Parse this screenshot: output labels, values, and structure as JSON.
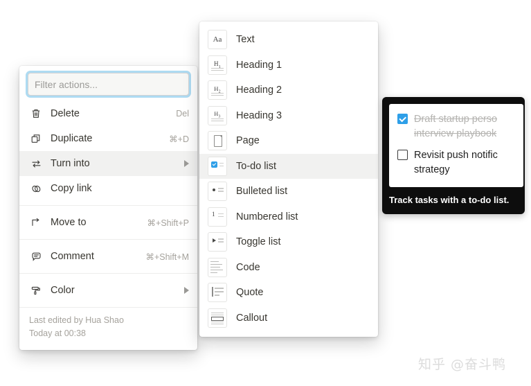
{
  "block_menu": {
    "filter": {
      "placeholder": "Filter actions...",
      "value": ""
    },
    "groups": [
      {
        "items": [
          {
            "icon": "trash-icon",
            "label": "Delete",
            "shortcut": "Del",
            "submenu": false,
            "active": false
          },
          {
            "icon": "duplicate-icon",
            "label": "Duplicate",
            "shortcut": "⌘+D",
            "submenu": false,
            "active": false
          },
          {
            "icon": "turn-into-icon",
            "label": "Turn into",
            "shortcut": "",
            "submenu": true,
            "active": true
          },
          {
            "icon": "link-icon",
            "label": "Copy link",
            "shortcut": "",
            "submenu": false,
            "active": false
          }
        ]
      },
      {
        "items": [
          {
            "icon": "move-to-icon",
            "label": "Move to",
            "shortcut": "⌘+Shift+P",
            "submenu": false,
            "active": false
          }
        ]
      },
      {
        "items": [
          {
            "icon": "comment-icon",
            "label": "Comment",
            "shortcut": "⌘+Shift+M",
            "submenu": false,
            "active": false
          }
        ]
      },
      {
        "items": [
          {
            "icon": "paint-roller-icon",
            "label": "Color",
            "shortcut": "",
            "submenu": true,
            "active": false
          }
        ]
      }
    ],
    "footer": {
      "last_edited": "Last edited by Hua Shao",
      "timestamp": "Today at 00:38"
    }
  },
  "turn_into_menu": {
    "items": [
      {
        "thumb": "text-thumb-icon",
        "label": "Text",
        "active": false
      },
      {
        "thumb": "heading-1-thumb-icon",
        "label": "Heading 1",
        "active": false
      },
      {
        "thumb": "heading-2-thumb-icon",
        "label": "Heading 2",
        "active": false
      },
      {
        "thumb": "heading-3-thumb-icon",
        "label": "Heading 3",
        "active": false
      },
      {
        "thumb": "page-thumb-icon",
        "label": "Page",
        "active": false
      },
      {
        "thumb": "todo-list-thumb-icon",
        "label": "To-do list",
        "active": true
      },
      {
        "thumb": "bulleted-list-thumb-icon",
        "label": "Bulleted list",
        "active": false
      },
      {
        "thumb": "numbered-list-thumb-icon",
        "label": "Numbered list",
        "active": false
      },
      {
        "thumb": "toggle-list-thumb-icon",
        "label": "Toggle list",
        "active": false
      },
      {
        "thumb": "code-thumb-icon",
        "label": "Code",
        "active": false
      },
      {
        "thumb": "quote-thumb-icon",
        "label": "Quote",
        "active": false
      },
      {
        "thumb": "callout-thumb-icon",
        "label": "Callout",
        "active": false
      }
    ]
  },
  "preview_tooltip": {
    "todos": [
      {
        "checked": true,
        "lines": [
          "Draft startup perso",
          "interview playbook"
        ]
      },
      {
        "checked": false,
        "lines": [
          "Revisit push notific",
          "strategy"
        ]
      }
    ],
    "caption": "Track tasks with a to-do list."
  },
  "watermark": "知乎 @奋斗鸭",
  "colors": {
    "accent_blue": "#2e9fe8",
    "focus_ring": "#6bbee7",
    "menu_hover": "#f1f1f0",
    "text_primary": "#37352f",
    "text_muted": "#a5a29c",
    "tooltip_bg": "#0d0d0d"
  }
}
